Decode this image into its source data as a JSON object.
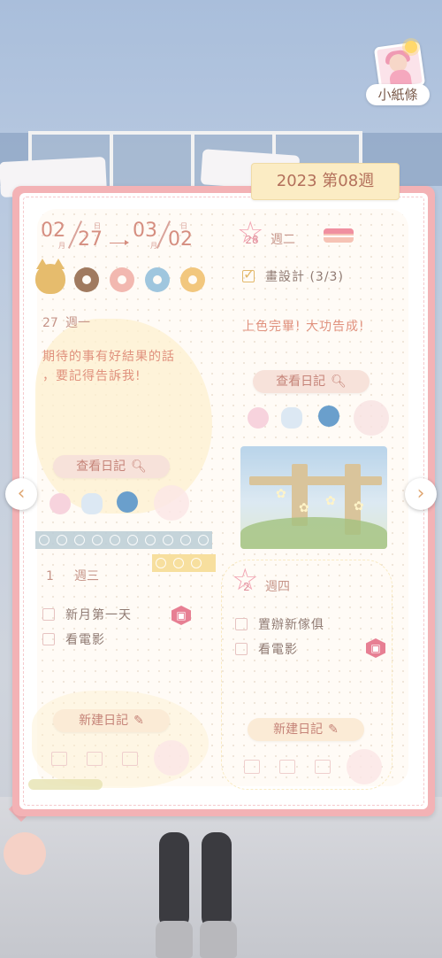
{
  "profile": {
    "name": "小紙條"
  },
  "journal": {
    "week_label": "2023 第08週",
    "date_range": {
      "start_month": "02",
      "start_day": "27",
      "end_month": "03",
      "end_day": "02",
      "month_unit": "月",
      "day_unit": "日"
    },
    "stamp_icons": [
      "cat-stamp-icon",
      "chocolate-donut-icon",
      "pink-donut-icon",
      "blue-donut-icon",
      "yellow-donut-icon"
    ],
    "days": [
      {
        "num": "27",
        "weekday": "週一",
        "note_line1": "期待的事有好結果的話",
        "note_line2": "，要記得告訴我!",
        "button": "查看日記"
      },
      {
        "num": "28",
        "weekday": "週二",
        "task": "畫設計 (3/3)",
        "task_checked": true,
        "note": "上色完畢! 大功告成!",
        "button": "查看日記"
      },
      {
        "num": "1",
        "weekday": "週三",
        "tasks": [
          "新月第一天",
          "看電影"
        ],
        "button": "新建日記"
      },
      {
        "num": "2",
        "weekday": "週四",
        "tasks": [
          "置辦新傢俱",
          "看電影"
        ],
        "button": "新建日記"
      }
    ]
  },
  "nav": {
    "prev": "‹",
    "next": "›"
  },
  "colors": {
    "accent": "#e0917d",
    "border": "#f3b2b5",
    "tab": "#fbecc4"
  }
}
